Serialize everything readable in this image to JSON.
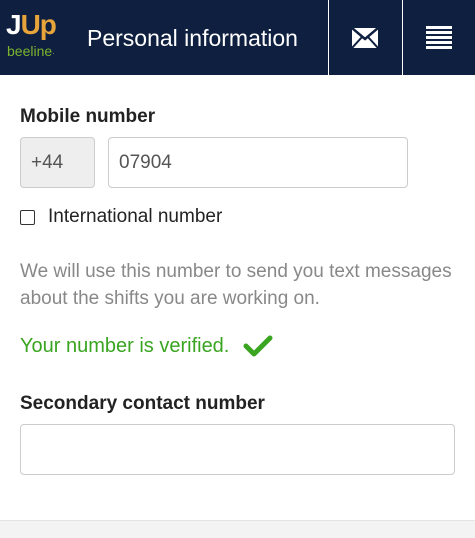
{
  "header": {
    "logo_main": "J",
    "logo_accent": "Up",
    "logo_sub": "beeline",
    "logo_tm": "·",
    "title": "Personal information",
    "mail_icon": "envelope-icon",
    "menu_icon": "hamburger-menu-icon",
    "background": "#0e1f3f"
  },
  "form": {
    "mobile_label": "Mobile number",
    "country_code": "+44",
    "phone_value": "07904",
    "international_label": "International number",
    "international_checked": false,
    "help_text": "We will use this number to send you text messages about the shifts you are working on.",
    "verified_text": "Your number is verified.",
    "verified_icon": "checkmark-icon",
    "verified_color": "#3aa520",
    "secondary_label": "Secondary contact number",
    "secondary_value": ""
  }
}
